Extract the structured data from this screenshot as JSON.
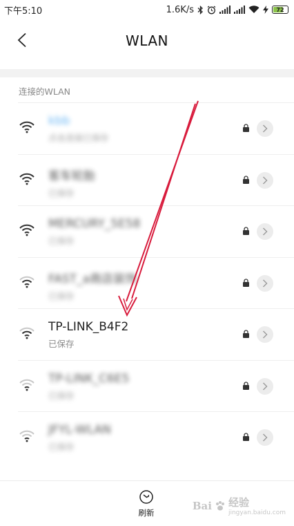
{
  "status_bar": {
    "time": "下午5:10",
    "network_speed": "1.6K/s",
    "battery_level": "72",
    "battery_percent": 72
  },
  "nav": {
    "title": "WLAN",
    "back_icon": "chevron-left-icon"
  },
  "section": {
    "header": "连接的WLAN"
  },
  "networks": [
    {
      "name": "kbb",
      "status": "点击连接已保存",
      "blurred": true,
      "color": "#3a9ff0"
    },
    {
      "name": "客车轮胎",
      "status": "已保存",
      "blurred": true
    },
    {
      "name": "MERCURY_5E58",
      "status": "已保存",
      "blurred": true
    },
    {
      "name": "FAST_a商店装饰",
      "status": "已保存",
      "blurred": true
    },
    {
      "name": "TP-LINK_B4F2",
      "status": "已保存",
      "blurred": false
    },
    {
      "name": "TP-LINK_C6E5",
      "status": "已保存",
      "blurred": true
    },
    {
      "name": "JFYL-WLAN",
      "status": "已保存",
      "blurred": true
    }
  ],
  "bottom": {
    "refresh_label": "刷新"
  },
  "watermark": {
    "brand": "Bai",
    "brand2": "经验",
    "url": "jingyan.baidu.com"
  },
  "colors": {
    "accent_blue": "#3a9ff0",
    "annotation_red": "#d81b3c",
    "battery_green": "#8bc34a"
  }
}
